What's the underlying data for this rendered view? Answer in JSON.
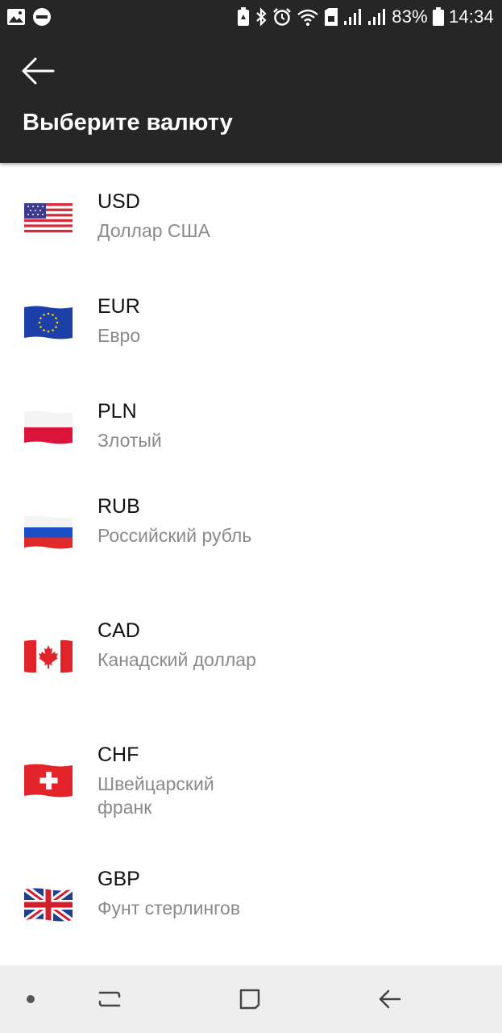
{
  "status_bar": {
    "battery_percent": "83%",
    "time": "14:34",
    "icons": [
      "gallery-icon",
      "do-not-disturb-icon",
      "battery-saver-icon",
      "bluetooth-icon",
      "alarm-icon",
      "wifi-icon",
      "sim-icon",
      "signal-icon",
      "signal-icon",
      "battery-icon"
    ]
  },
  "header": {
    "back_icon": "arrow-left-icon",
    "title": "Выберите валюту"
  },
  "currencies": [
    {
      "code": "USD",
      "name": "Доллар США",
      "flag": "us-flag-icon"
    },
    {
      "code": "EUR",
      "name": "Евро",
      "flag": "eu-flag-icon"
    },
    {
      "code": "PLN",
      "name": "Злотый",
      "flag": "pl-flag-icon"
    },
    {
      "code": "RUB",
      "name": "Российский рубль",
      "flag": "ru-flag-icon"
    },
    {
      "code": "CAD",
      "name": "Канадский доллар",
      "flag": "ca-flag-icon"
    },
    {
      "code": "CHF",
      "name": "Швейцарский франк",
      "flag": "ch-flag-icon"
    },
    {
      "code": "GBP",
      "name": "Фунт стерлингов",
      "flag": "gb-flag-icon"
    }
  ],
  "nav_bar": {
    "icons": [
      "dot-icon",
      "recents-icon",
      "home-icon",
      "back-icon"
    ]
  },
  "colors": {
    "bar_background": "#262626",
    "code_text": "#111111",
    "name_text": "#8a8a8a",
    "nav_background": "#eeeeee"
  }
}
